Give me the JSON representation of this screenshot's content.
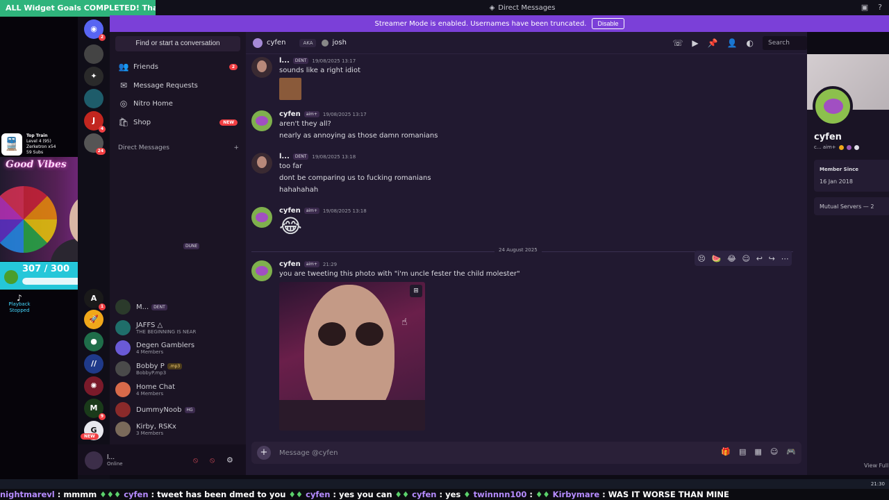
{
  "goal_banner": "ALL Widget Goals COMPLETED! Thank You!",
  "title_bar": {
    "title": "Direct Messages"
  },
  "streamer_bar": {
    "message": "Streamer Mode is enabled. Usernames have been truncated.",
    "disable_label": "Disable"
  },
  "overlay": {
    "train_title": "Top Train",
    "train_level": "Level 4 (95)",
    "train_user": "Zerketron x54",
    "train_subs": "59 Subs",
    "good_vibes": "Good Vibes",
    "progress_text": "307 / 300",
    "progress_fraction": 1.0,
    "playback_status": "Playback Stopped"
  },
  "rail": {
    "home_badge": "2",
    "badges": [
      "4",
      "24",
      "1",
      "9"
    ],
    "server_a_letter": "A",
    "new_label": "NEW"
  },
  "sidebar": {
    "search_placeholder": "Find or start a conversation",
    "nav": [
      {
        "label": "Friends",
        "count": "2"
      },
      {
        "label": "Message Requests"
      },
      {
        "label": "Nitro Home"
      },
      {
        "label": "Shop",
        "badge": "NEW"
      }
    ],
    "dm_header": "Direct Messages",
    "dm_add": "+",
    "dms": [
      {
        "name": "DUNE",
        "sub": ""
      },
      {
        "name": "M...",
        "tag": "DENT",
        "sub": ""
      },
      {
        "name": "JAFFS △",
        "sub": "THE BEGINNING IS NEAR"
      },
      {
        "name": "Degen Gamblers",
        "sub": "4 Members"
      },
      {
        "name": "Bobby P",
        "tag": ".mp3",
        "sub": "BobbyP.mp3"
      },
      {
        "name": "Home Chat",
        "sub": "4 Members"
      },
      {
        "name": "DummyNoob",
        "tag": "HG",
        "sub": ""
      },
      {
        "name": "Kirby, RSKx",
        "sub": "3 Members"
      }
    ]
  },
  "userbar": {
    "name": "l...",
    "status": "Online"
  },
  "chat": {
    "header_user": "cyfen",
    "aka_label": "AKA",
    "aka_name": "josh",
    "search_label": "Search",
    "messages": [
      {
        "author": "l...",
        "tag": "DENT",
        "time": "19/08/2025 13:17",
        "lines": [
          "sounds like a right idiot"
        ]
      },
      {
        "author": "cyfen",
        "tag": "aim+",
        "time": "19/08/2025 13:17",
        "lines": [
          "aren't they all?",
          "nearly as annoying as those damn romanians"
        ]
      },
      {
        "author": "l...",
        "tag": "DENT",
        "time": "19/08/2025 13:18",
        "lines": [
          "too far",
          "dont be comparing us to fucking romanians",
          "hahahahah"
        ]
      },
      {
        "author": "cyfen",
        "tag": "aim+",
        "time": "19/08/2025 13:18",
        "emoji": "😂"
      }
    ],
    "date_divider": "24 August 2025",
    "last_message": {
      "author": "cyfen",
      "tag": "aim+",
      "time": "21:29",
      "line": "you are tweeting this photo with \"i'm uncle fester the child molester\""
    },
    "composer_placeholder": "Message @cyfen"
  },
  "profile": {
    "name": "cyfen",
    "tags": "c... aim+",
    "member_since_label": "Member Since",
    "member_since": "16 Jan 2018",
    "mutual_servers": "Mutual Servers — 2",
    "view_full": "View Full"
  },
  "taskbar": {
    "time": "21:30"
  },
  "ticker": [
    {
      "name": "nightmarevl",
      "msg": ": mmmm"
    },
    {
      "name": "cyfen",
      "msg": ": tweet has been dmed to you"
    },
    {
      "name": "cyfen",
      "msg": ": yes you can"
    },
    {
      "name": "cyfen",
      "msg": ": yes"
    },
    {
      "name": "twinnnn100",
      "msg": ":"
    },
    {
      "name": "Kirbymare",
      "msg": ": WAS IT WORSE THAN MINE"
    }
  ]
}
